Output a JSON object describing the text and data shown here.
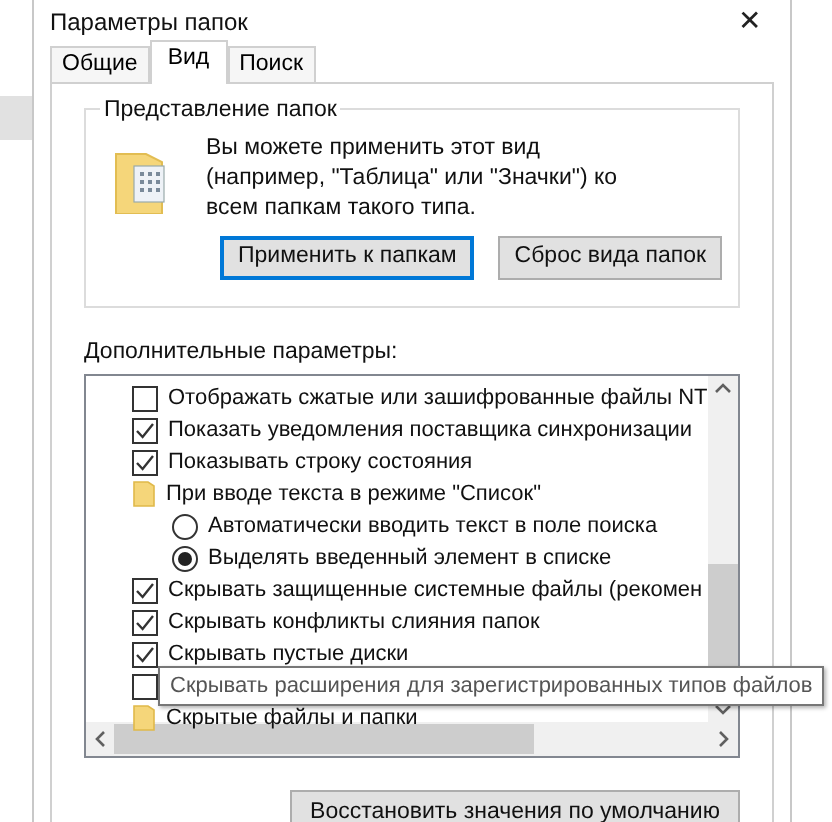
{
  "window": {
    "title": "Параметры папок",
    "close": "✕"
  },
  "tabs": [
    {
      "label": "Общие",
      "selected": false
    },
    {
      "label": "Вид",
      "selected": true
    },
    {
      "label": "Поиск",
      "selected": false
    }
  ],
  "folder_views": {
    "title": "Представление папок",
    "text": "Вы можете применить этот вид (например, \"Таблица\" или \"Значки\") ко всем папкам такого типа.",
    "buttons": [
      "Применить к папкам",
      "Сброс вида папок"
    ]
  },
  "advanced": {
    "label": "Дополнительные параметры:",
    "items": [
      {
        "kind": "checkbox",
        "label": "Отображать сжатые или зашифрованные файлы NT",
        "checked": false
      },
      {
        "kind": "checkbox",
        "label": "Показать уведомления поставщика синхронизации",
        "checked": true
      },
      {
        "kind": "checkbox",
        "label": "Показывать строку состояния",
        "checked": true
      },
      {
        "kind": "folder",
        "label": "При вводе текста в режиме \"Список\"",
        "children": [
          {
            "kind": "radio",
            "label": "Автоматически вводить текст в поле поиска",
            "selected": false
          },
          {
            "kind": "radio",
            "label": "Выделять введенный элемент в списке",
            "selected": true
          }
        ]
      },
      {
        "kind": "checkbox",
        "label": "Скрывать защищенные системные файлы (рекомен",
        "checked": true
      },
      {
        "kind": "checkbox",
        "label": "Скрывать конфликты слияния папок",
        "checked": true
      },
      {
        "kind": "checkbox",
        "label": "Скрывать пустые диски",
        "checked": true
      },
      {
        "kind": "checkbox",
        "checked": false,
        "tooltip": "Скрывать расширения для зарегистрированных типов файлов"
      },
      {
        "kind": "folder",
        "label": "Скрытые файлы и папки"
      }
    ]
  },
  "restore_button": "Восстановить значения по умолчанию"
}
